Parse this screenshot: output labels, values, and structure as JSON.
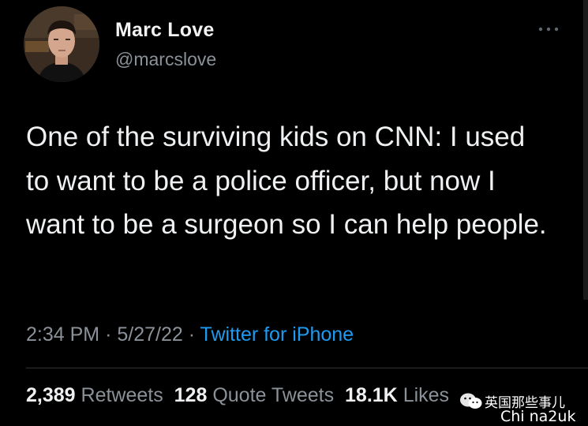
{
  "author": {
    "name": "Marc Love",
    "handle": "@marcslove"
  },
  "tweet": {
    "text": "One of the surviving kids on CNN: I used to want to be a police officer, but now I want to be a surgeon so I can help people.",
    "time": "2:34 PM",
    "separator": "·",
    "date": "5/27/22",
    "source": "Twitter for iPhone"
  },
  "stats": {
    "retweets_count": "2,389",
    "retweets_label": "Retweets",
    "quote_count": "128",
    "quote_label": "Quote Tweets",
    "likes_count": "18.1K",
    "likes_label": "Likes"
  },
  "icons": {
    "more": "more-horizontal-icon",
    "watermark_logo": "wechat-icon"
  },
  "watermark": {
    "line1": "英国那些事儿",
    "line2": "Chi na2uk"
  },
  "colors": {
    "background": "#000000",
    "text": "#eef0f2",
    "secondary": "#8b9198",
    "link": "#1d9bf0"
  }
}
